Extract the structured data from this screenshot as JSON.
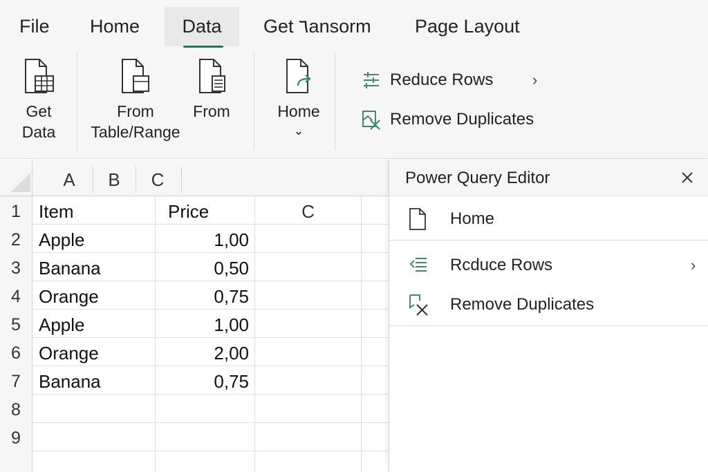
{
  "tabs": [
    {
      "label": "File",
      "active": false
    },
    {
      "label": "Home",
      "active": false
    },
    {
      "label": "Data",
      "active": true
    },
    {
      "label": "Get ٦ansorm",
      "active": false
    },
    {
      "label": "Page Layout",
      "active": false
    }
  ],
  "ribbon": {
    "get_data": {
      "line1": "Get",
      "line2": "Data"
    },
    "from_table": {
      "line1": "From",
      "line2": "Table/Range"
    },
    "from": {
      "label": "From"
    },
    "home": {
      "label": "Home",
      "dropdown_glyph": "⌄"
    },
    "reduce_rows": {
      "label": "Reduce Rows",
      "arrow": "›"
    },
    "remove_duplicates": {
      "label": "Remove Duplicates"
    }
  },
  "grid": {
    "column_headers": [
      "A",
      "B",
      "C"
    ],
    "row_numbers": [
      "1",
      "2",
      "3",
      "4",
      "5",
      "6",
      "7",
      "8",
      "9"
    ],
    "header_row": {
      "item": "Item",
      "price": "Price",
      "c": "C"
    },
    "rows": [
      {
        "item": "Apple",
        "price": "1,00"
      },
      {
        "item": "Banana",
        "price": "0,50"
      },
      {
        "item": "Orange",
        "price": "0,75"
      },
      {
        "item": "Apple",
        "price": "1,00"
      },
      {
        "item": "Orange",
        "price": "2,00"
      },
      {
        "item": "Banana",
        "price": "0,75"
      }
    ]
  },
  "power_query": {
    "title": "Power Query Editor",
    "close_glyph": "×",
    "home_label": "Home",
    "reduce_rows_label": "Rcduce Rows",
    "reduce_rows_arrow": "›",
    "remove_duplicates_label": "Remove Duplicates"
  },
  "colors": {
    "accent": "#2f6f57",
    "icon_green": "#3f8a6c"
  }
}
